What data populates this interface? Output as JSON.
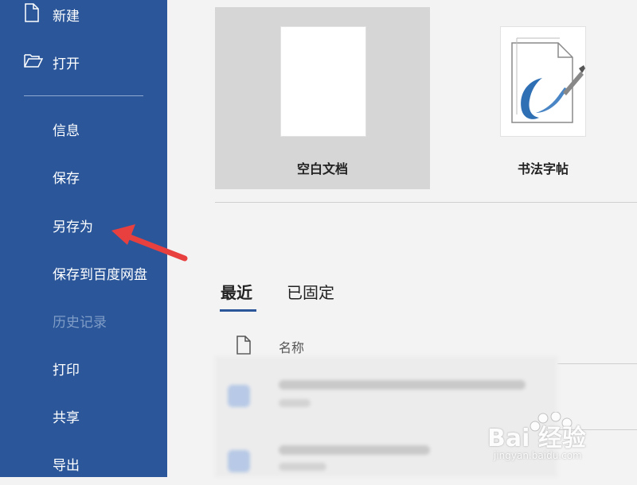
{
  "sidebar": {
    "items": [
      {
        "label": "新建",
        "icon": "new-document-icon"
      },
      {
        "label": "打开",
        "icon": "folder-open-icon"
      },
      {
        "label": "信息"
      },
      {
        "label": "保存"
      },
      {
        "label": "另存为"
      },
      {
        "label": "保存到百度网盘"
      },
      {
        "label": "历史记录",
        "disabled": true
      },
      {
        "label": "打印"
      },
      {
        "label": "共享"
      },
      {
        "label": "导出"
      }
    ],
    "background": "#2b579a"
  },
  "templates": [
    {
      "label": "空白文档",
      "selected": true
    },
    {
      "label": "书法字帖"
    }
  ],
  "tabs": [
    {
      "label": "最近",
      "active": true
    },
    {
      "label": "已固定"
    }
  ],
  "file_list": {
    "column_name": "名称"
  },
  "watermark": {
    "text": "Bai 经验",
    "url": "jingyan.baidu.com"
  },
  "annotation": {
    "arrow_color": "#e8403f",
    "points_to": "另存为"
  }
}
